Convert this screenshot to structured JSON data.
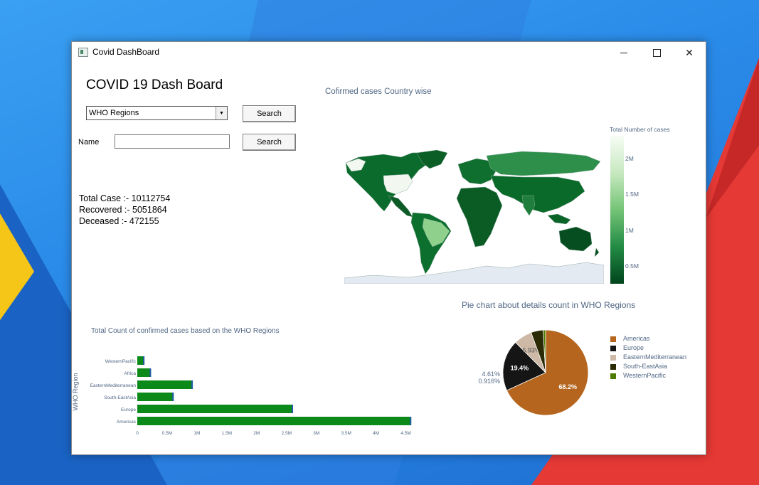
{
  "window": {
    "title": "Covid DashBoard"
  },
  "dashboard": {
    "title": "COVID 19 Dash Board",
    "region_select_value": "WHO Regions",
    "search_label_1": "Search",
    "search_label_2": "Search",
    "name_label": "Name",
    "name_value": "",
    "stats": {
      "total": "Total Case :- 10112754",
      "recovered": "Recovered :- 5051864",
      "deceased": "Deceased :- 472155"
    }
  },
  "map": {
    "title": "Cofirmed cases Country wise",
    "colorbar_title": "Total Number of cases",
    "colorbar_ticks": [
      "2M",
      "1.5M",
      "1M",
      "0.5M"
    ]
  },
  "bar": {
    "title": "Total Count of confirmed cases based on the WHO Regions"
  },
  "pie": {
    "title": "Pie chart about details count in WHO Regions"
  },
  "chart_data": [
    {
      "type": "bar",
      "orientation": "horizontal",
      "title": "Total Count of confirmed cases based on the WHO Regions",
      "xlabel": "",
      "ylabel": "WHO Region",
      "categories": [
        "WesternPacific",
        "Africa",
        "EasternMediterranean",
        "South-EastAsia",
        "Europe",
        "Americas"
      ],
      "values": [
        120000,
        230000,
        930000,
        610000,
        2610000,
        4590000
      ],
      "xlim": [
        0,
        4600000
      ],
      "xticks": [
        "0",
        "0.5M",
        "1M",
        "1.5M",
        "2M",
        "2.5M",
        "3M",
        "3.5M",
        "4M",
        "4.5M"
      ],
      "xtick_values": [
        0,
        500000,
        1000000,
        1500000,
        2000000,
        2500000,
        3000000,
        3500000,
        4000000,
        4500000
      ],
      "colors": {
        "bar": "#0b8a1a",
        "edge": "#1e5aa8"
      }
    },
    {
      "type": "pie",
      "title": "Pie chart about details count in WHO Regions",
      "categories": [
        "Americas",
        "Europe",
        "EasternMediterranean",
        "South-EastAsia",
        "WesternPacific"
      ],
      "values": [
        68.2,
        19.4,
        6.93,
        4.61,
        0.916
      ],
      "labels": [
        "68.2%",
        "19.4%",
        "6.93%",
        "4.61%",
        "0.916%"
      ],
      "colors": [
        "#b5651d",
        "#151515",
        "#cdb9a5",
        "#2b2b05",
        "#4e7a00"
      ],
      "legend": "right"
    }
  ]
}
